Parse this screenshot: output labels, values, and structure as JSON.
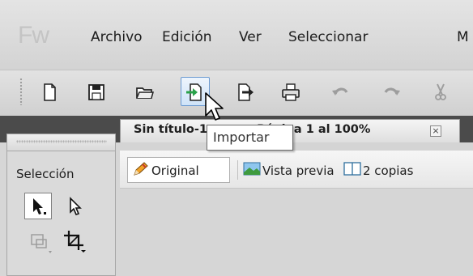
{
  "app": {
    "logo": "Fw"
  },
  "menu": {
    "items": [
      "Archivo",
      "Edición",
      "Ver",
      "Seleccionar",
      "M"
    ]
  },
  "toolbar": {
    "buttons": [
      {
        "name": "new-document",
        "icon": "new-document-icon"
      },
      {
        "name": "save",
        "icon": "save-icon"
      },
      {
        "name": "open",
        "icon": "open-folder-icon"
      },
      {
        "name": "import",
        "icon": "import-icon",
        "state": "hover"
      },
      {
        "name": "export",
        "icon": "export-icon"
      },
      {
        "name": "print",
        "icon": "print-icon"
      },
      {
        "name": "undo",
        "icon": "undo-icon",
        "state": "disabled"
      },
      {
        "name": "redo",
        "icon": "redo-icon",
        "state": "disabled"
      },
      {
        "name": "cut",
        "icon": "cut-icon",
        "state": "disabled"
      }
    ],
    "tooltip": "Importar"
  },
  "document": {
    "tab_title": "Sin título-1.png @ Página 1 al 100%",
    "tab_close": "×"
  },
  "tools": {
    "section_label": "Selección"
  },
  "views": {
    "original": "Original",
    "preview": "Vista previa",
    "two_up": "2 copias"
  },
  "colors": {
    "menubar": "#d9d9d9",
    "darkband": "#4b4b4b",
    "hover_frame": "#6d9bd1",
    "import_arrow": "#2aa24a"
  }
}
